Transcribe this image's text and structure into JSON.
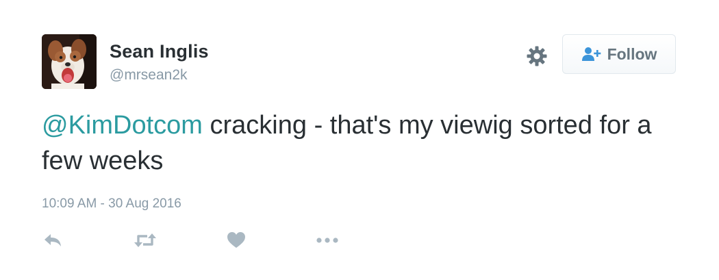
{
  "user": {
    "name": "Sean Inglis",
    "handle": "@mrsean2k"
  },
  "follow_button": {
    "label": "Follow",
    "icon": "add-user-icon"
  },
  "settings_icon": "gear-icon",
  "tweet": {
    "mention": "@KimDotcom",
    "text": " cracking - that's my viewig sorted for a few weeks",
    "timestamp": "10:09 AM - 30 Aug 2016"
  },
  "actions": [
    "reply-icon",
    "retweet-icon",
    "like-icon",
    "more-icon"
  ],
  "colors": {
    "name": "#292f33",
    "muted": "#8899a6",
    "mention": "#2b9ba0",
    "follow_icon": "#3b94d9",
    "icons": "#aab8c2"
  }
}
